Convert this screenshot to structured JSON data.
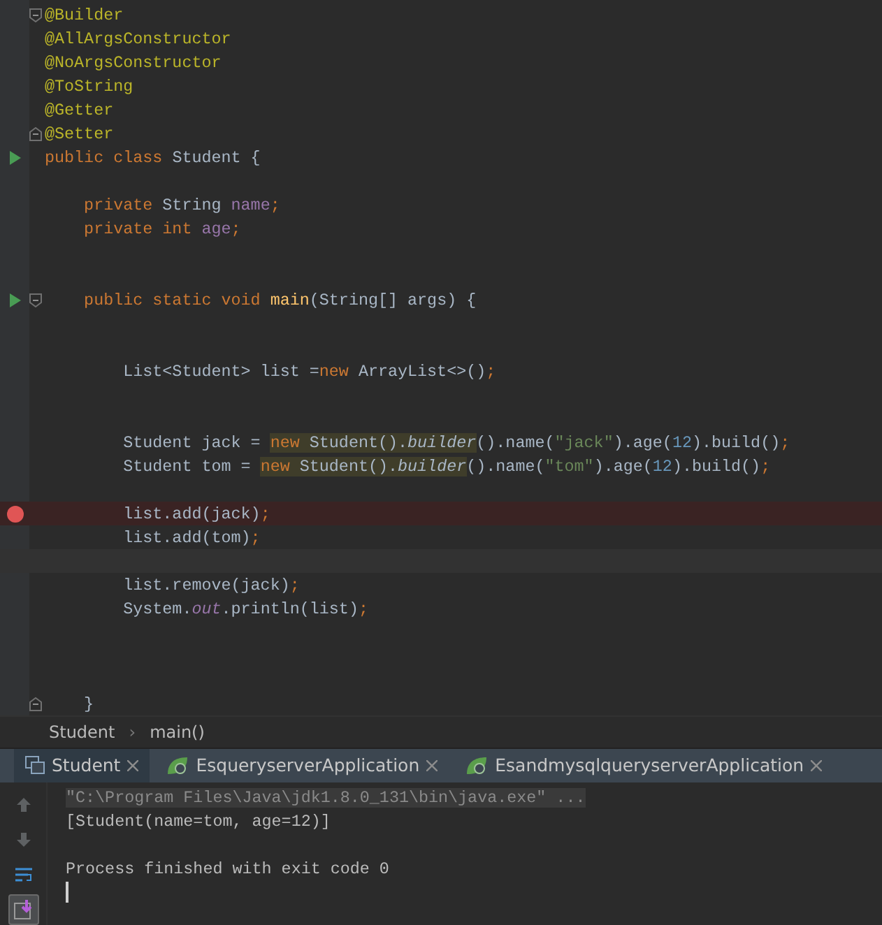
{
  "editor": {
    "lines": [
      {
        "kind": "plain",
        "fold": {
          "kind": "start"
        },
        "tokens": [
          {
            "kind": "ann",
            "t": "@Builder"
          }
        ]
      },
      {
        "kind": "plain",
        "tokens": [
          {
            "kind": "ann",
            "t": "@AllArgsConstructor"
          }
        ]
      },
      {
        "kind": "plain",
        "tokens": [
          {
            "kind": "ann",
            "t": "@NoArgsConstructor"
          }
        ]
      },
      {
        "kind": "plain",
        "tokens": [
          {
            "kind": "ann",
            "t": "@ToString"
          }
        ]
      },
      {
        "kind": "plain",
        "tokens": [
          {
            "kind": "ann",
            "t": "@Getter"
          }
        ]
      },
      {
        "kind": "plain",
        "fold": {
          "kind": "end"
        },
        "tokens": [
          {
            "kind": "ann",
            "t": "@Setter"
          }
        ]
      },
      {
        "kind": "run",
        "tokens": [
          {
            "kind": "kw",
            "t": "public class "
          },
          {
            "kind": "plain",
            "t": "Student {"
          }
        ]
      },
      {
        "kind": "plain"
      },
      {
        "kind": "plain",
        "tokens": [
          {
            "kind": "kw",
            "t": "    private "
          },
          {
            "kind": "plain",
            "t": "String "
          },
          {
            "kind": "field",
            "t": "name"
          },
          {
            "kind": "kw",
            "t": ";"
          }
        ]
      },
      {
        "kind": "plain",
        "tokens": [
          {
            "kind": "kw",
            "t": "    private int "
          },
          {
            "kind": "field",
            "t": "age"
          },
          {
            "kind": "kw",
            "t": ";"
          }
        ]
      },
      {
        "kind": "plain"
      },
      {
        "kind": "plain"
      },
      {
        "kind": "run",
        "fold": {
          "kind": "start"
        },
        "tokens": [
          {
            "kind": "kw",
            "t": "    public static void "
          },
          {
            "kind": "method",
            "t": "main"
          },
          {
            "kind": "plain",
            "t": "(String[] args) {"
          }
        ]
      },
      {
        "kind": "plain"
      },
      {
        "kind": "plain"
      },
      {
        "kind": "plain",
        "tokens": [
          {
            "kind": "plain",
            "t": "        List<Student> list ="
          },
          {
            "kind": "kw",
            "t": "new"
          },
          {
            "kind": "plain",
            "t": " ArrayList<>()"
          },
          {
            "kind": "kw",
            "t": ";"
          }
        ]
      },
      {
        "kind": "plain"
      },
      {
        "kind": "plain"
      },
      {
        "kind": "plain",
        "tokens": [
          {
            "kind": "plain",
            "t": "        Student jack = "
          },
          {
            "kind": "highlight",
            "tokens": [
              {
                "kind": "kw",
                "t": "new"
              },
              {
                "kind": "plain",
                "t": " Student()."
              },
              {
                "kind": "italic",
                "t": "builder"
              }
            ]
          },
          {
            "kind": "plain",
            "t": "().name("
          },
          {
            "kind": "str",
            "t": "\"jack\""
          },
          {
            "kind": "plain",
            "t": ").age("
          },
          {
            "kind": "num",
            "t": "12"
          },
          {
            "kind": "plain",
            "t": ").build()"
          },
          {
            "kind": "kw",
            "t": ";"
          }
        ]
      },
      {
        "kind": "plain",
        "tokens": [
          {
            "kind": "plain",
            "t": "        Student tom = "
          },
          {
            "kind": "highlight",
            "tokens": [
              {
                "kind": "kw",
                "t": "new"
              },
              {
                "kind": "plain",
                "t": " Student()."
              },
              {
                "kind": "italic",
                "t": "builder"
              }
            ]
          },
          {
            "kind": "plain",
            "t": "().name("
          },
          {
            "kind": "str",
            "t": "\"tom\""
          },
          {
            "kind": "plain",
            "t": ").age("
          },
          {
            "kind": "num",
            "t": "12"
          },
          {
            "kind": "plain",
            "t": ").build()"
          },
          {
            "kind": "kw",
            "t": ";"
          }
        ]
      },
      {
        "kind": "plain"
      },
      {
        "kind": "breakpoint",
        "tokens": [
          {
            "kind": "plain",
            "t": "        list.add(jack)"
          },
          {
            "kind": "kw",
            "t": ";"
          }
        ]
      },
      {
        "kind": "plain",
        "tokens": [
          {
            "kind": "plain",
            "t": "        list.add(tom)"
          },
          {
            "kind": "kw",
            "t": ";"
          }
        ]
      },
      {
        "kind": "caret"
      },
      {
        "kind": "plain",
        "tokens": [
          {
            "kind": "plain",
            "t": "        list.remove(jack)"
          },
          {
            "kind": "kw",
            "t": ";"
          }
        ]
      },
      {
        "kind": "plain",
        "tokens": [
          {
            "kind": "plain",
            "t": "        System."
          },
          {
            "kind": "static",
            "t": "out"
          },
          {
            "kind": "plain",
            "t": ".println(list)"
          },
          {
            "kind": "kw",
            "t": ";"
          }
        ]
      },
      {
        "kind": "plain"
      },
      {
        "kind": "plain"
      },
      {
        "kind": "plain"
      },
      {
        "kind": "plain",
        "fold": {
          "kind": "end"
        },
        "tokens": [
          {
            "kind": "plain",
            "t": "    }"
          }
        ]
      }
    ]
  },
  "breadcrumb": {
    "items": [
      "Student",
      "main()"
    ],
    "separator": "›"
  },
  "run_tabs": [
    {
      "label": "Student",
      "kind": "console",
      "selected": true
    },
    {
      "label": "EsqueryserverApplication",
      "kind": "spring",
      "selected": false
    },
    {
      "label": "EsandmysqlqueryserverApplication",
      "kind": "spring",
      "selected": false
    }
  ],
  "console_toolbar": [
    {
      "kind": "up",
      "selected": false
    },
    {
      "kind": "down",
      "selected": false
    },
    {
      "kind": "wrap",
      "selected": false
    },
    {
      "kind": "scroll",
      "selected": true
    }
  ],
  "console": [
    {
      "kind": "command",
      "text": "\"C:\\Program Files\\Java\\jdk1.8.0_131\\bin\\java.exe\" ..."
    },
    {
      "kind": "output",
      "text": "[Student(name=tom, age=12)]"
    },
    {
      "kind": "blank"
    },
    {
      "kind": "output",
      "text": "Process finished with exit code 0"
    },
    {
      "kind": "caret"
    }
  ]
}
